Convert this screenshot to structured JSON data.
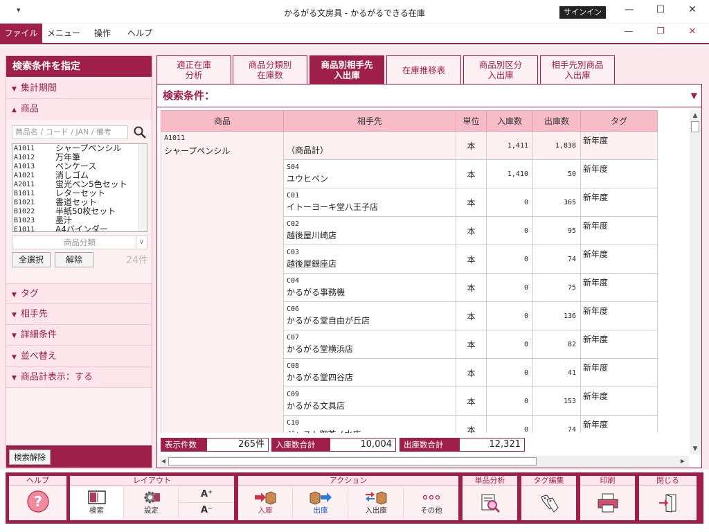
{
  "window": {
    "title": "かるがる文房具 - かるがるできる在庫",
    "signin": "サインイン",
    "quick_access": "▾"
  },
  "menu": {
    "file": "ファイル",
    "items": [
      "メニュー",
      "操作",
      "ヘルプ"
    ]
  },
  "left": {
    "title": "検索条件を指定",
    "sec_period": "集計期間",
    "sec_product": "商品",
    "search_placeholder": "商品名 / コード / JAN / 備考",
    "products": [
      {
        "code": "A1011",
        "name": "シャープペンシル"
      },
      {
        "code": "A1012",
        "name": "万年筆"
      },
      {
        "code": "A1013",
        "name": "ペンケース"
      },
      {
        "code": "A1021",
        "name": "消しゴム"
      },
      {
        "code": "A2011",
        "name": "蛍光ペン5色セット"
      },
      {
        "code": "B1011",
        "name": "レターセット"
      },
      {
        "code": "B1021",
        "name": "書道セット"
      },
      {
        "code": "B1022",
        "name": "半紙50枚セット"
      },
      {
        "code": "B1023",
        "name": "墨汁"
      },
      {
        "code": "E1011",
        "name": "A4バインダー"
      }
    ],
    "category_placeholder": "商品分類",
    "select_all": "全選択",
    "deselect": "解除",
    "count": "24件",
    "sec_tag": "タグ",
    "sec_partner": "相手先",
    "sec_detail": "詳細条件",
    "sec_sort": "並べ替え",
    "sec_total": "商品計表示：する",
    "clear": "検索解除"
  },
  "tabs": [
    {
      "label1": "適正在庫",
      "label2": "分析"
    },
    {
      "label1": "商品分類別",
      "label2": "在庫数"
    },
    {
      "label1": "商品別相手先",
      "label2": "入出庫"
    },
    {
      "label1": "在庫推移表",
      "label2": ""
    },
    {
      "label1": "商品別区分",
      "label2": "入出庫"
    },
    {
      "label1": "相手先別商品",
      "label2": "入出庫"
    }
  ],
  "condition_label": "検索条件：",
  "table": {
    "headers": [
      "商品",
      "相手先",
      "単位",
      "入庫数",
      "出庫数",
      "タグ"
    ],
    "product_code": "A1011",
    "product_name": "シャープペンシル",
    "rows": [
      {
        "code": "",
        "name": "（商品計）",
        "unit": "本",
        "in": "1,411",
        "out": "1,838",
        "tag": "新年度"
      },
      {
        "code": "S04",
        "name": "ユウヒペン",
        "unit": "本",
        "in": "1,410",
        "out": "50",
        "tag": "新年度"
      },
      {
        "code": "C01",
        "name": "イトーヨーキ堂八王子店",
        "unit": "本",
        "in": "0",
        "out": "365",
        "tag": "新年度"
      },
      {
        "code": "C02",
        "name": "越後屋川崎店",
        "unit": "本",
        "in": "0",
        "out": "95",
        "tag": "新年度"
      },
      {
        "code": "C03",
        "name": "越後屋銀座店",
        "unit": "本",
        "in": "0",
        "out": "74",
        "tag": "新年度"
      },
      {
        "code": "C04",
        "name": "かるがる事務機",
        "unit": "本",
        "in": "0",
        "out": "75",
        "tag": "新年度"
      },
      {
        "code": "C06",
        "name": "かるがる堂自由が丘店",
        "unit": "本",
        "in": "0",
        "out": "136",
        "tag": "新年度"
      },
      {
        "code": "C07",
        "name": "かるがる堂横浜店",
        "unit": "本",
        "in": "0",
        "out": "82",
        "tag": "新年度"
      },
      {
        "code": "C08",
        "name": "かるがる堂四谷店",
        "unit": "本",
        "in": "0",
        "out": "41",
        "tag": "新年度"
      },
      {
        "code": "C09",
        "name": "かるがる文具店",
        "unit": "本",
        "in": "0",
        "out": "153",
        "tag": "新年度"
      },
      {
        "code": "C10",
        "name": "ジャスト御茶ノ水店",
        "unit": "本",
        "in": "0",
        "out": "74",
        "tag": "新年度"
      }
    ]
  },
  "summary": {
    "display_label": "表示件数",
    "display_value": "265件",
    "in_label": "入庫数合計",
    "in_value": "10,004",
    "out_label": "出庫数合計",
    "out_value": "12,321"
  },
  "toolbar": {
    "help_hdr": "ヘルプ",
    "layout_hdr": "レイアウト",
    "search": "検索",
    "settings": "設定",
    "font_up": "A⁺",
    "font_down": "A⁻",
    "action_hdr": "アクション",
    "in": "入庫",
    "out": "出庫",
    "inout": "入出庫",
    "other": "その他",
    "analysis_hdr": "単品分析",
    "tag_hdr": "タグ編集",
    "print_hdr": "印刷",
    "close_hdr": "閉じる"
  },
  "colors": {
    "accent": "#9e1f4a",
    "header_pink": "#f7bcc7",
    "panel_bg": "#fdf0f3"
  }
}
